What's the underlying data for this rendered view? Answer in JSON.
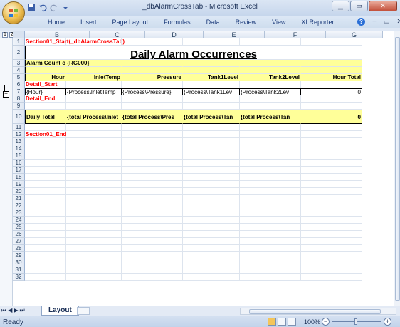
{
  "window": {
    "title": "_dbAlarmCrossTab - Microsoft Excel"
  },
  "ribbon": {
    "tabs": [
      "Home",
      "Insert",
      "Page Layout",
      "Formulas",
      "Data",
      "Review",
      "View",
      "XLReporter"
    ]
  },
  "outline": {
    "levels": [
      "1",
      "2"
    ]
  },
  "columns": [
    "B",
    "C",
    "D",
    "E",
    "F",
    "G"
  ],
  "rows": [
    {
      "num": "1",
      "cells": [
        {
          "text": "Section01_Start(_dbAlarmCrossTab)",
          "style": "red"
        }
      ]
    },
    {
      "num": "2",
      "cells": [
        {
          "text": "Daily Alarm Occurrences",
          "style": "title"
        }
      ]
    },
    {
      "num": "3",
      "cells": [
        {
          "text": "Alarm Count on",
          "style": "bold"
        },
        {
          "text": "{RG000}",
          "style": "bold"
        }
      ]
    },
    {
      "num": "4",
      "cells": []
    },
    {
      "num": "5",
      "cells": [
        {
          "text": "Hour",
          "style": "hdr"
        },
        {
          "text": "InletTemp",
          "style": "hdr"
        },
        {
          "text": "Pressure",
          "style": "hdr"
        },
        {
          "text": "Tank1Level",
          "style": "hdr"
        },
        {
          "text": "Tank2Level",
          "style": "hdr"
        },
        {
          "text": "Hour Total",
          "style": "hdr"
        }
      ]
    },
    {
      "num": "6",
      "cells": [
        {
          "text": "Detail_Start",
          "style": "red"
        }
      ]
    },
    {
      "num": "7",
      "cells": [
        {
          "text": "{Hour}",
          "style": "plain"
        },
        {
          "text": "{Process\\InletTemp",
          "style": "plain"
        },
        {
          "text": "{Process\\Pressure}",
          "style": "plain"
        },
        {
          "text": "{Process\\Tank1Lev",
          "style": "plain"
        },
        {
          "text": "{Process\\Tank2Lev",
          "style": "plain"
        },
        {
          "text": "0",
          "style": "plain"
        }
      ]
    },
    {
      "num": "8",
      "cells": [
        {
          "text": "Detail_End",
          "style": "red"
        }
      ]
    },
    {
      "num": "9",
      "cells": []
    },
    {
      "num": "10",
      "cells": [
        {
          "text": "Daily Total",
          "style": "bold"
        },
        {
          "text": "{total Process\\Inlet",
          "style": "bold"
        },
        {
          "text": "{total Process\\Pres",
          "style": "bold"
        },
        {
          "text": "{total Process\\Tan",
          "style": "bold"
        },
        {
          "text": "{total Process\\Tan",
          "style": "bold"
        },
        {
          "text": "0",
          "style": "bold"
        }
      ]
    },
    {
      "num": "11",
      "cells": []
    },
    {
      "num": "12",
      "cells": [
        {
          "text": "Section01_End",
          "style": "red"
        }
      ]
    },
    {
      "num": "13"
    },
    {
      "num": "14"
    },
    {
      "num": "15"
    },
    {
      "num": "16"
    },
    {
      "num": "17"
    },
    {
      "num": "18"
    },
    {
      "num": "19"
    },
    {
      "num": "20"
    },
    {
      "num": "21"
    },
    {
      "num": "22"
    },
    {
      "num": "23"
    },
    {
      "num": "24"
    },
    {
      "num": "25"
    },
    {
      "num": "26"
    },
    {
      "num": "27"
    },
    {
      "num": "28"
    },
    {
      "num": "29"
    },
    {
      "num": "30"
    },
    {
      "num": "31"
    },
    {
      "num": "32"
    }
  ],
  "sheet_tabs": [
    "Layout"
  ],
  "status": {
    "text": "Ready",
    "zoom": "100%"
  },
  "colors": {
    "red": "#ff0000",
    "yellow": "#ffff99",
    "title_blue": "#000000"
  }
}
